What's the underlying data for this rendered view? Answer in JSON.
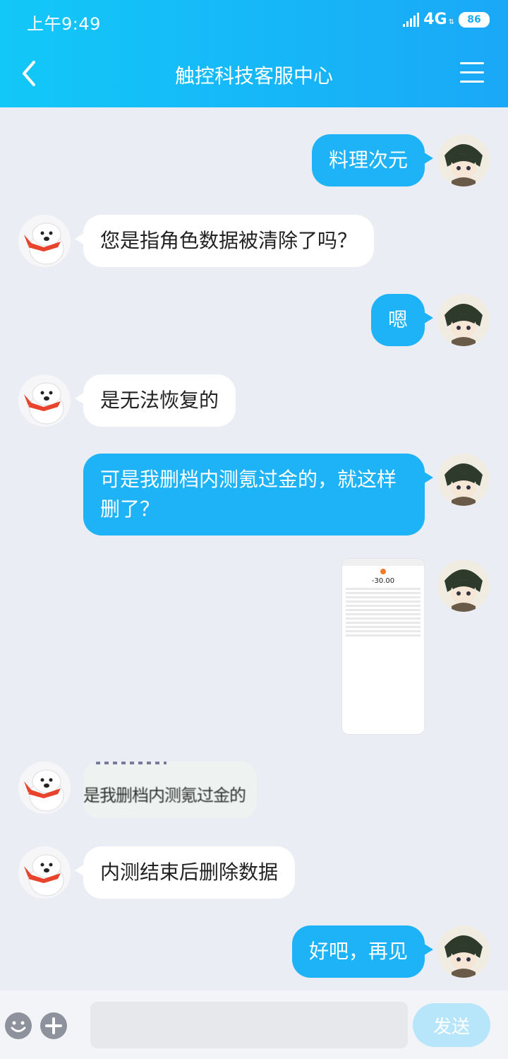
{
  "status_bar": {
    "time": "上午9:49",
    "network": "4G",
    "battery": "86"
  },
  "header": {
    "title": "触控科技客服中心"
  },
  "messages": [
    {
      "side": "out",
      "text": "料理次元"
    },
    {
      "side": "in",
      "text": "您是指角色数据被清除了吗？"
    },
    {
      "side": "out",
      "text": "嗯"
    },
    {
      "side": "in",
      "text": "是无法恢复的"
    },
    {
      "side": "out",
      "text": "可是我删档内测氪过金的，就这样删了？"
    },
    {
      "side": "in",
      "text": "内测结束后删除数据"
    },
    {
      "side": "out",
      "text": "好吧，再见"
    }
  ],
  "receipt_image": {
    "amount": "-30.00"
  },
  "garbled_image": {
    "text": "是我删档内测氪过金的"
  },
  "input": {
    "value": "",
    "send_label": "发送"
  },
  "colors": {
    "header_start": "#12c8f8",
    "header_end": "#1aa8f7",
    "outgoing_bubble": "#1eb3f6",
    "incoming_bubble": "#ffffff",
    "chat_background": "#ebedf4"
  }
}
